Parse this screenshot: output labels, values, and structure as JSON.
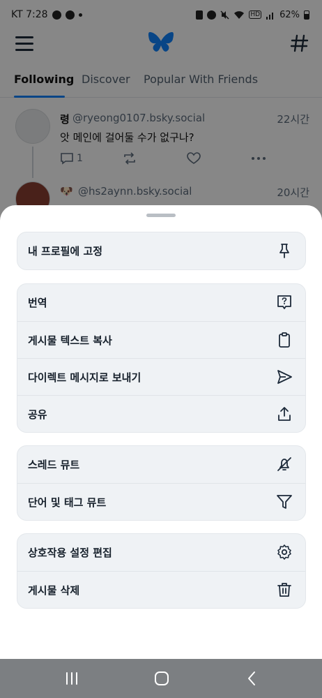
{
  "status_bar": {
    "carrier_time": "KT 7:28",
    "battery": "62%",
    "icons": [
      "notification-icon",
      "messenger-icon",
      "dot-icon",
      "lock-icon",
      "alarm-icon",
      "mute-icon",
      "wifi-icon",
      "hd-icon",
      "signal-icon",
      "battery-icon"
    ]
  },
  "header": {
    "logo": "butterfly-logo-icon",
    "brand_color": "#1083fe"
  },
  "tabs": [
    {
      "label": "Following",
      "active": true
    },
    {
      "label": "Discover",
      "active": false
    },
    {
      "label": "Popular With Friends",
      "active": false
    }
  ],
  "posts": [
    {
      "name": "령",
      "handle": "@ryeong0107.bsky.social",
      "time": "22시간",
      "text": "앗 메인에 걸어둘 수가 없구나?",
      "reply_count": "1"
    },
    {
      "name": "🐶",
      "handle": "@hs2aynn.bsky.social",
      "time": "20시간"
    }
  ],
  "sheet": {
    "groups": [
      {
        "items": [
          {
            "label": "내 프로필에 고정",
            "icon": "pin-icon"
          }
        ]
      },
      {
        "items": [
          {
            "label": "번역",
            "icon": "translate-icon"
          },
          {
            "label": "게시물 텍스트 복사",
            "icon": "clipboard-icon"
          },
          {
            "label": "다이렉트 메시지로 보내기",
            "icon": "send-icon"
          },
          {
            "label": "공유",
            "icon": "share-icon"
          }
        ]
      },
      {
        "items": [
          {
            "label": "스레드 뮤트",
            "icon": "bell-slash-icon"
          },
          {
            "label": "단어 및 태그 뮤트",
            "icon": "filter-icon"
          }
        ]
      },
      {
        "items": [
          {
            "label": "상호작용 설정 편집",
            "icon": "gear-icon"
          },
          {
            "label": "게시물 삭제",
            "icon": "trash-icon"
          }
        ]
      }
    ]
  },
  "nav_bar": {
    "buttons": [
      "recent-apps-icon",
      "home-icon",
      "back-icon"
    ]
  }
}
